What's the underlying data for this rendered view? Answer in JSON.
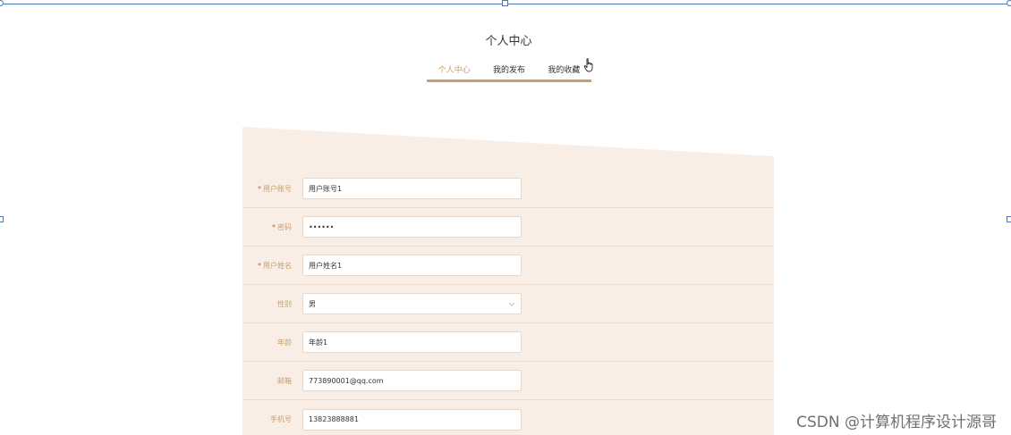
{
  "page": {
    "title": "个人中心",
    "tabs": [
      {
        "label": "个人中心",
        "active": true
      },
      {
        "label": "我的发布",
        "active": false
      },
      {
        "label": "我的收藏",
        "active": false
      }
    ]
  },
  "form": {
    "fields": [
      {
        "label": "用户账号",
        "required": true,
        "value": "用户账号1",
        "type": "text"
      },
      {
        "label": "密码",
        "required": true,
        "value": "••••••",
        "type": "password"
      },
      {
        "label": "用户姓名",
        "required": true,
        "value": "用户姓名1",
        "type": "text"
      },
      {
        "label": "性别",
        "required": false,
        "value": "男",
        "type": "select"
      },
      {
        "label": "年龄",
        "required": false,
        "value": "年龄1",
        "type": "text"
      },
      {
        "label": "邮箱",
        "required": false,
        "value": "773890001@qq.com",
        "type": "text"
      },
      {
        "label": "手机号",
        "required": false,
        "value": "13823888881",
        "type": "text"
      }
    ]
  },
  "watermark": "CSDN @计算机程序设计源哥",
  "colors": {
    "accent": "#c59f6d",
    "card_bg": "#f9eee6",
    "required": "#e4554a",
    "selection": "#4a78b5"
  }
}
